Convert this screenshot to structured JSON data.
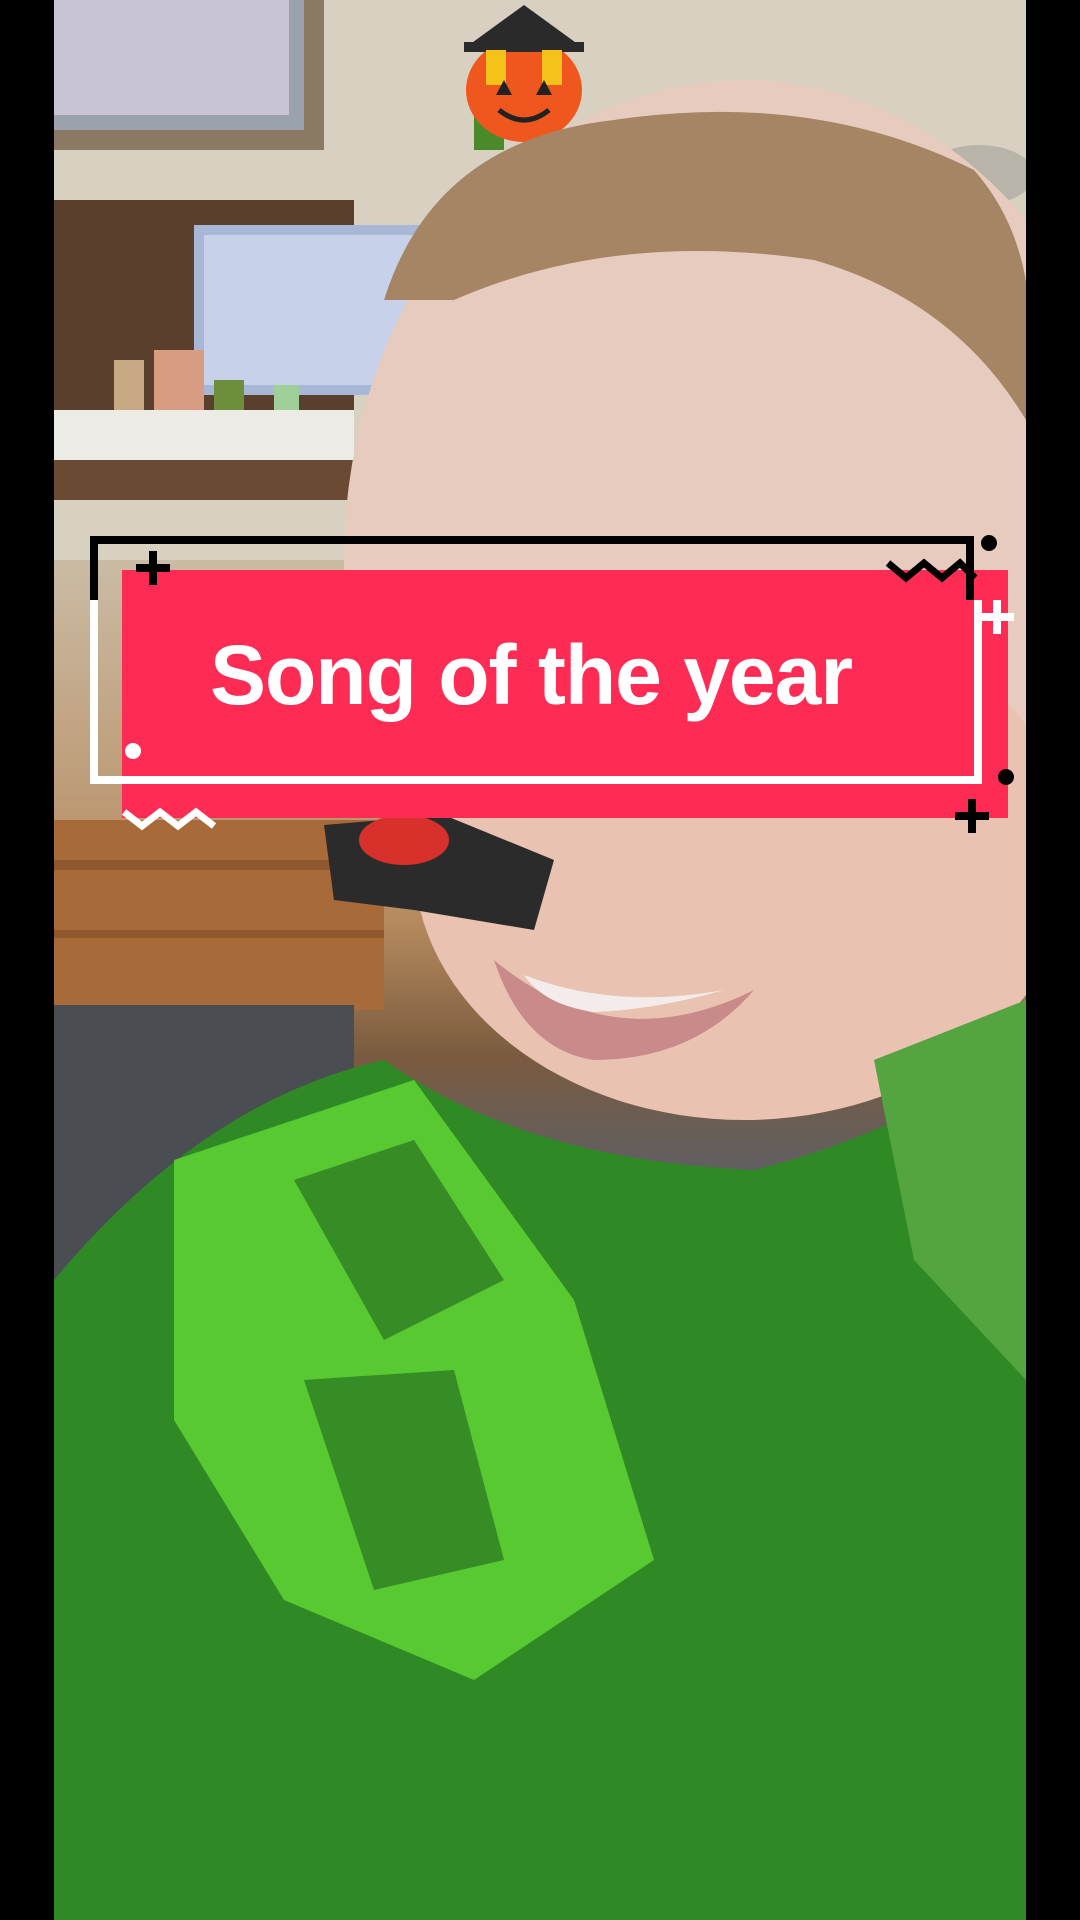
{
  "caption": {
    "text": "Song of the year"
  },
  "colors": {
    "caption_background": "#fe2c55",
    "caption_text": "#ffffff",
    "accent_dark": "#000000",
    "accent_light": "#ffffff"
  },
  "scene": {
    "description_icon": "child-in-costume-photo"
  }
}
